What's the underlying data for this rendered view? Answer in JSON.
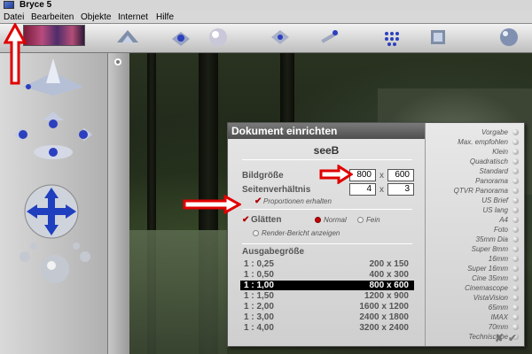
{
  "window": {
    "title": "Bryce 5"
  },
  "menu": [
    "Datei",
    "Bearbeiten",
    "Objekte",
    "Internet",
    "Hilfe"
  ],
  "dialog": {
    "title": "Dokument einrichten",
    "document_name": "seeB",
    "bildgroesse_label": "Bildgröße",
    "width": "800",
    "height": "600",
    "size_sep": "x",
    "ratio_label": "Seitenverhältnis",
    "ratio_w": "4",
    "ratio_h": "3",
    "keep_proportions_label": "Proportionen erhalten",
    "smoothing_label": "Glätten",
    "smoothing_normal": "Normal",
    "smoothing_fine": "Fein",
    "render_report_label": "Render-Bericht anzeigen",
    "output_size_label": "Ausgabegröße",
    "output_sizes": [
      {
        "scale": "1 : 0,25",
        "size": "200 x 150"
      },
      {
        "scale": "1 : 0,50",
        "size": "400 x 300"
      },
      {
        "scale": "1 : 1,00",
        "size": "800 x 600"
      },
      {
        "scale": "1 : 1,50",
        "size": "1200 x 900"
      },
      {
        "scale": "1 : 2,00",
        "size": "1600 x 1200"
      },
      {
        "scale": "1 : 3,00",
        "size": "2400 x 1800"
      },
      {
        "scale": "1 : 4,00",
        "size": "3200 x 2400"
      }
    ],
    "selected_output_index": 2,
    "presets": [
      "Vorgabe",
      "Max. empfohlen",
      "Klein",
      "Quadratisch",
      "Standard",
      "Panorama",
      "QTVR Panorama",
      "US Brief",
      "US lang",
      "A4",
      "Foto",
      "35mm Dia",
      "Super 8mm",
      "16mm",
      "Super 16mm",
      "Cine 35mm",
      "Cinemascope",
      "VistaVision",
      "65mm",
      "IMAX",
      "70mm",
      "Techniscope"
    ],
    "cancel_glyph": "✘",
    "ok_glyph": "✔"
  },
  "colors": {
    "accent_red": "#e00000",
    "selection": "#000000"
  }
}
